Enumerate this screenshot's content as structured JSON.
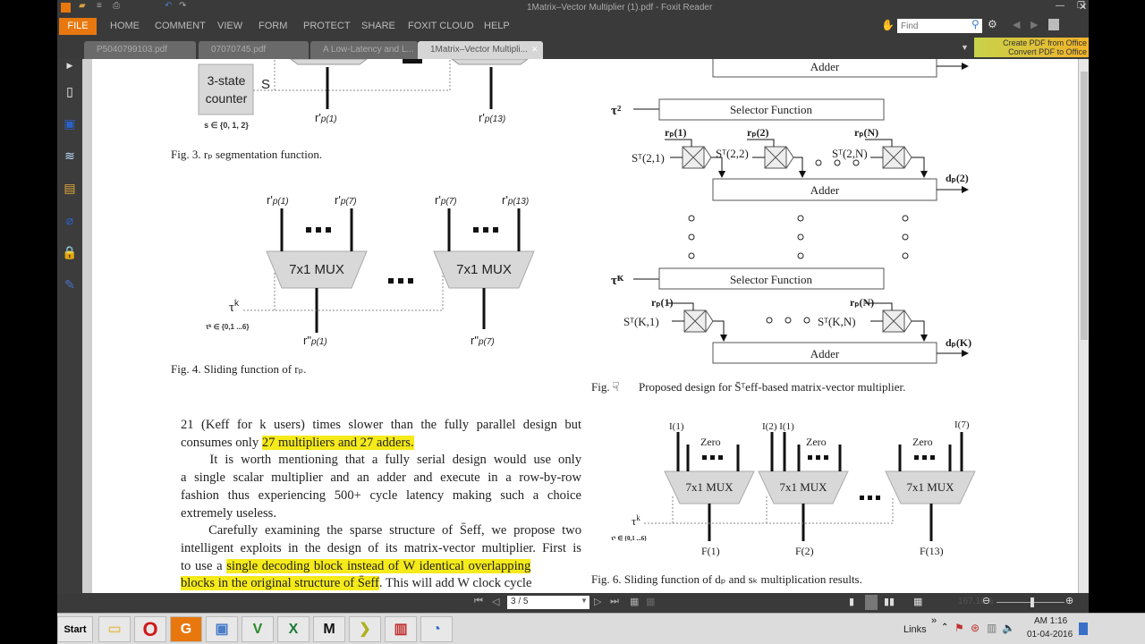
{
  "window": {
    "title": "1Matrix–Vector Multiplier (1).pdf - Foxit Reader"
  },
  "ribbon": {
    "file": "FILE",
    "tabs": [
      "HOME",
      "COMMENT",
      "VIEW",
      "FORM",
      "PROTECT",
      "SHARE",
      "FOXIT CLOUD",
      "HELP"
    ],
    "find_placeholder": "Find",
    "promo1": "Create PDF from Office",
    "promo2": "Convert PDF to Office"
  },
  "doc_tabs": [
    "P5040799103.pdf",
    "07070745.pdf",
    "A Low-Latency and L...",
    "1Matrix–Vector Multipli..."
  ],
  "fig3": {
    "counter1": "3-state",
    "counter2": "counter",
    "s": "S",
    "s_range": "s ∈ {0, 1, 2}",
    "out1": "r'",
    "out1_sub": "p(1)",
    "out2": "r'",
    "out2_sub": "p(13)",
    "caption": "Fig. 3.   rₚ segmentation function."
  },
  "fig4": {
    "mux": "7x1 MUX",
    "in": [
      [
        "r'",
        "p(1)"
      ],
      [
        "r'",
        "p(7)"
      ],
      [
        "r'",
        "p(7)"
      ],
      [
        "r'",
        "p(13)"
      ]
    ],
    "out": [
      [
        "r\"",
        "p(1)"
      ],
      [
        "r\"",
        "p(7)"
      ]
    ],
    "tau": "τ",
    "tau_sup": "k",
    "tau_range": "τᵏ ∈ {0,1 ...6}",
    "caption": "Fig. 4.   Sliding function of rₚ."
  },
  "fig5": {
    "selector": "Selector Function",
    "adder": "Adder",
    "tau2": "τ²",
    "tauK": "τᴷ",
    "r1": "rₚ(1)",
    "r2": "rₚ(2)",
    "rN": "rₚ(N)",
    "s21": "Sᵀ(2,1)",
    "s22": "Sᵀ(2,2)",
    "s2N": "Sᵀ(2,N)",
    "sK1": "Sᵀ(K,1)",
    "sKN": "Sᵀ(K,N)",
    "d2": "dₚ(2)",
    "dK": "dₚ(K)",
    "caption_pre": "Fig.",
    "caption": "Proposed design for S̄ᵀeff-based matrix-vector multiplier."
  },
  "fig6": {
    "mux": "7x1 MUX",
    "zero": "Zero",
    "i1": "I(1)",
    "i21": "I(2) I(1)",
    "i7": "I(7)",
    "f1": "F(1)",
    "f2": "F(2)",
    "f13": "F(13)",
    "tau": "τ",
    "tau_sup": "k",
    "tau_range": "τᵏ ∈ {0,1 ...6}",
    "caption": "Fig. 6.   Sliding function of dₚ and sₖ multiplication results."
  },
  "text": {
    "l1": "21 (Keff for k users) times slower than the fully parallel design but",
    "l2a": "consumes only ",
    "l2h": "27 multipliers and 27 adders.",
    "l3": "    It is worth mentioning that a fully serial design would use only",
    "l4": "a single scalar multiplier and an adder and execute in a row-by-row",
    "l5": "fashion thus experiencing 500+ cycle latency making such a choice",
    "l6": "extremely useless.",
    "l7": "    Carefully examining the sparse structure of S̄eff, we propose two",
    "l8": "intelligent exploits in the design of its matrix-vector multiplier. First is",
    "l9a": "to use a ",
    "l9h": "single decoding block instead of W identical overlapping",
    "l10h": "blocks in the original structure of S̄eff",
    "l10b": ". This will add W clock cycle"
  },
  "status": {
    "page": "3 / 5",
    "zoom": "167.16%"
  },
  "taskbar": {
    "start": "Start",
    "links": "Links",
    "chev": "»",
    "time": "AM 1:16",
    "date": "01-04-2016"
  },
  "colors": {
    "accent": "#e8780e",
    "highlight": "#f5ea1a"
  }
}
